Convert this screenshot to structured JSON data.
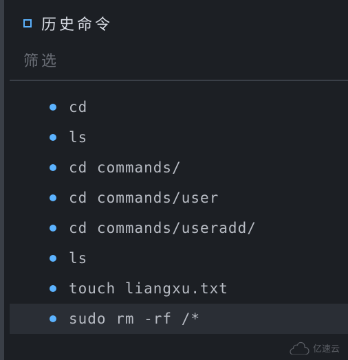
{
  "header": {
    "title": "历史命令"
  },
  "filter": {
    "placeholder": "筛选",
    "value": ""
  },
  "commands": [
    {
      "text": "cd",
      "highlighted": false
    },
    {
      "text": "ls",
      "highlighted": false
    },
    {
      "text": "cd commands/",
      "highlighted": false
    },
    {
      "text": "cd commands/user",
      "highlighted": false
    },
    {
      "text": "cd commands/useradd/",
      "highlighted": false
    },
    {
      "text": "ls",
      "highlighted": false
    },
    {
      "text": "touch liangxu.txt",
      "highlighted": false
    },
    {
      "text": "sudo rm -rf /*",
      "highlighted": true
    }
  ],
  "watermark": {
    "text": "亿速云"
  }
}
